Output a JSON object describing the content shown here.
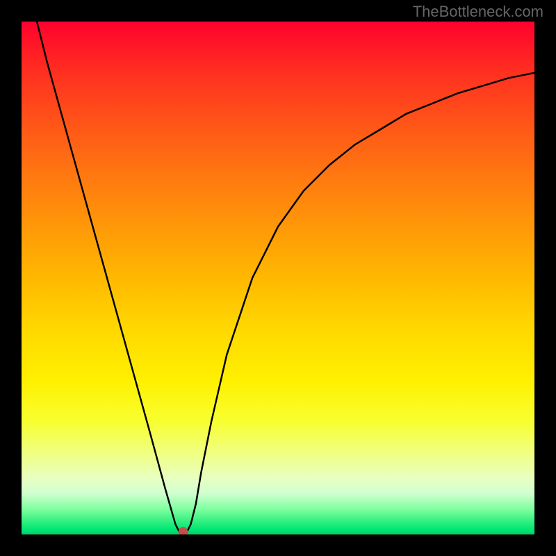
{
  "watermark": "TheBottleneck.com",
  "chart_data": {
    "type": "line",
    "title": "",
    "xlabel": "",
    "ylabel": "",
    "xlim": [
      0,
      100
    ],
    "ylim": [
      0,
      100
    ],
    "series": [
      {
        "name": "bottleneck-curve",
        "x": [
          3,
          5,
          10,
          15,
          20,
          25,
          28,
          30,
          31,
          32,
          33,
          34,
          35,
          37,
          40,
          45,
          50,
          55,
          60,
          65,
          70,
          75,
          80,
          85,
          90,
          95,
          100
        ],
        "values": [
          100,
          92,
          74,
          56,
          38,
          20,
          9,
          2,
          0,
          0,
          2,
          6,
          12,
          22,
          35,
          50,
          60,
          67,
          72,
          76,
          79,
          82,
          84,
          86,
          87.5,
          89,
          90
        ]
      }
    ],
    "optimal_point": {
      "x": 31.5,
      "y": 0.5
    },
    "background_gradient": {
      "type": "vertical",
      "stops": [
        {
          "pos": 0,
          "color": "#ff0030"
        },
        {
          "pos": 50,
          "color": "#ffb800"
        },
        {
          "pos": 78,
          "color": "#f8ff30"
        },
        {
          "pos": 100,
          "color": "#00d068"
        }
      ]
    },
    "grid": false
  }
}
